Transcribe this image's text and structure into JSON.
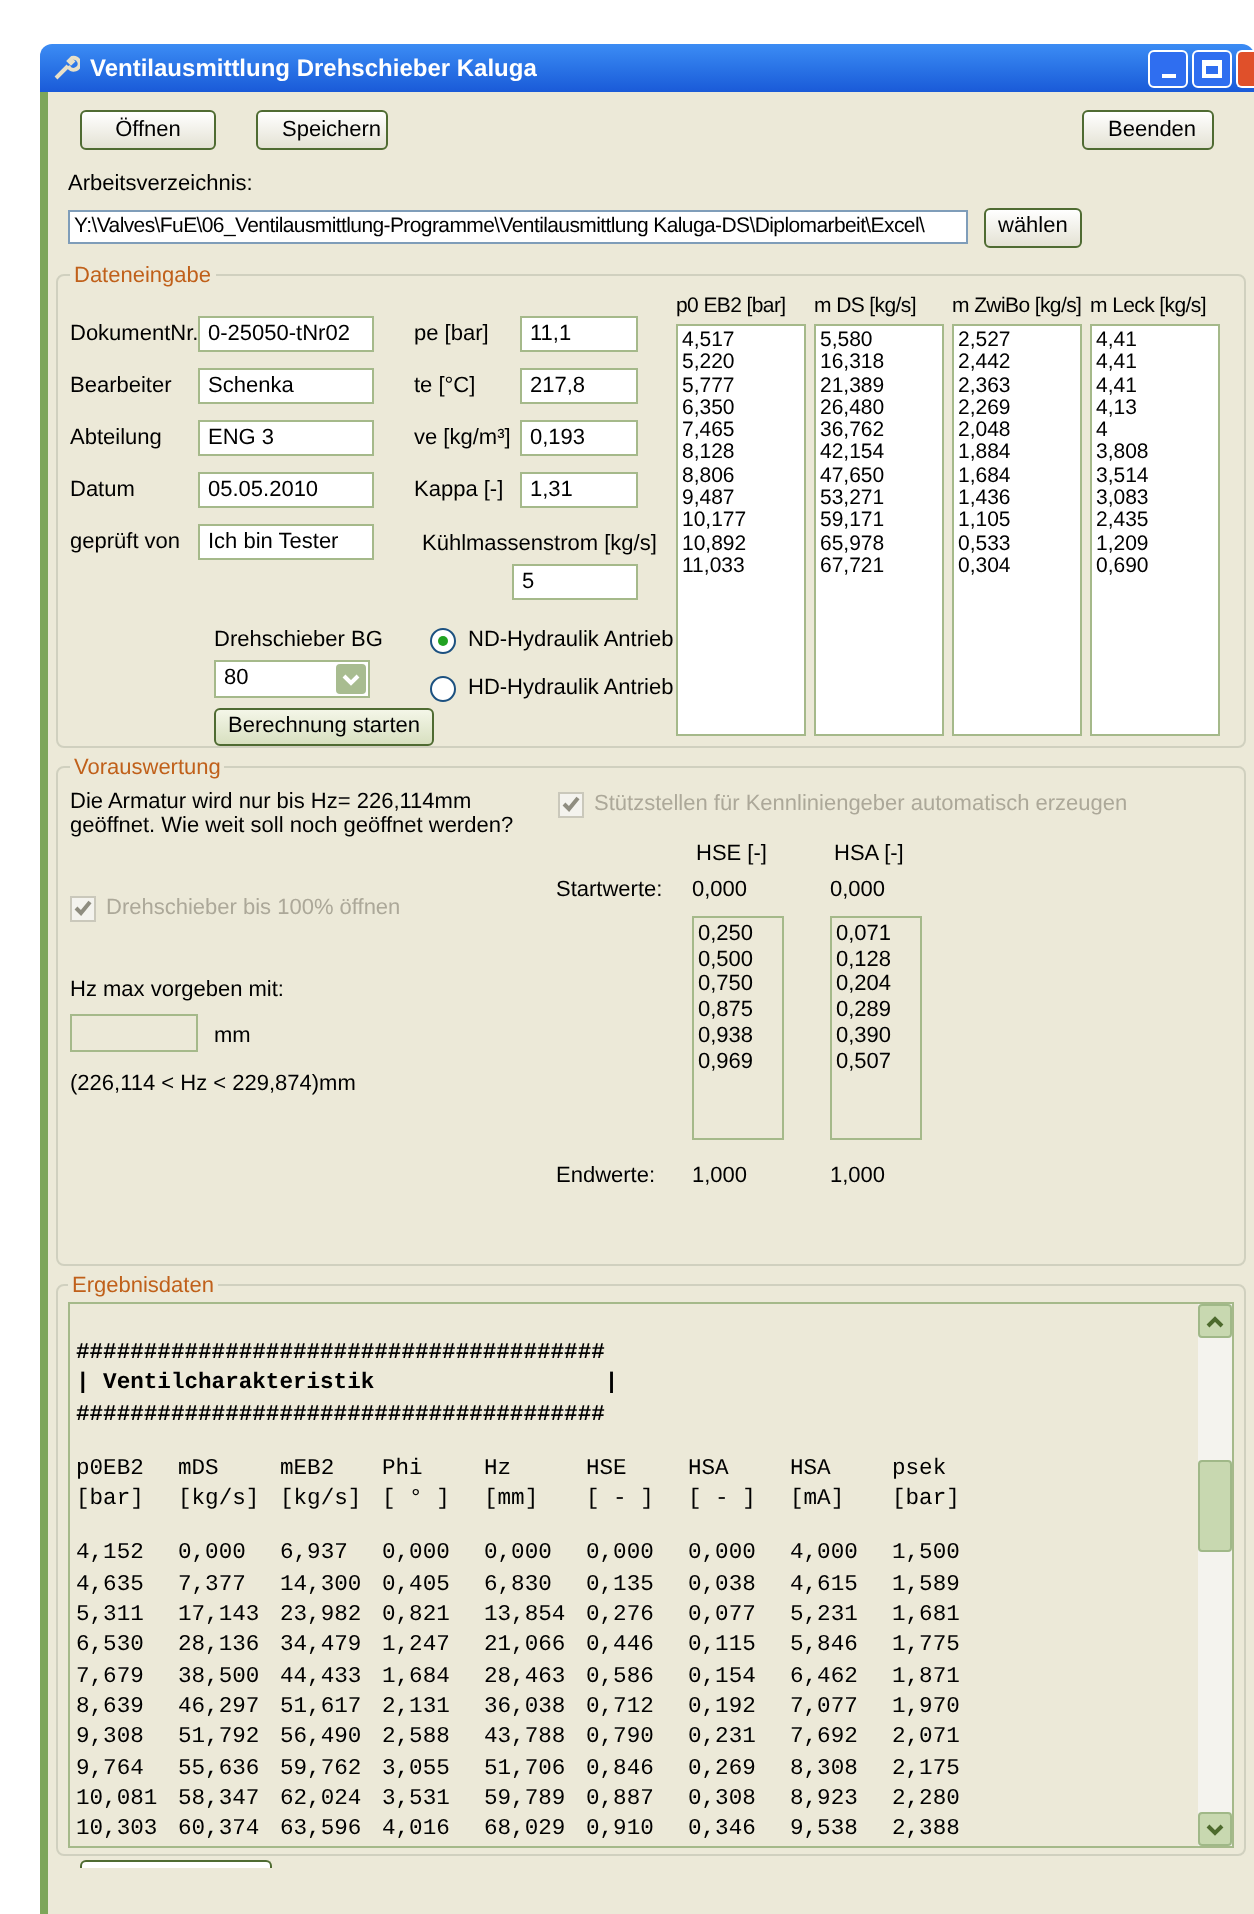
{
  "window": {
    "title": "Ventilausmittlung Drehschieber Kaluga"
  },
  "toolbar": {
    "left_buttons": [
      "Öffnen",
      "Speichern"
    ],
    "right_button": "Beenden"
  },
  "workdir": {
    "label": "Arbeitsverzeichnis:",
    "value": "Y:\\Valves\\FuE\\06_Ventilausmittlung-Programme\\Ventilausmittlung Kaluga-DS\\Diplomarbeit\\Excel\\",
    "button": "wählen"
  },
  "data_input": {
    "title": "Dateneingabe",
    "fields_left": [
      {
        "label": "DokumentNr.",
        "value": "0-25050-tNr02"
      },
      {
        "label": "Bearbeiter",
        "value": "Schenka"
      },
      {
        "label": "Abteilung",
        "value": "ENG 3"
      },
      {
        "label": "Datum",
        "value": "05.05.2010"
      },
      {
        "label": "geprüft von",
        "value": "Ich bin Tester"
      }
    ],
    "fields_right": [
      {
        "label": "pe [bar]",
        "value": "11,1"
      },
      {
        "label": "te [°C]",
        "value": "217,8"
      },
      {
        "label": "ve [kg/m³]",
        "value": "0,193"
      },
      {
        "label": "Kappa [-]",
        "value": "1,31"
      }
    ],
    "coolant": {
      "label": "Kühlmassenstrom [kg/s]",
      "value": "5"
    },
    "size": {
      "label": "Drehschieber BG",
      "value": "80"
    },
    "start_button": "Berechnung starten",
    "drive": [
      {
        "label": "ND-Hydraulik Antrieb",
        "selected": true
      },
      {
        "label": "HD-Hydraulik Antrieb",
        "selected": false
      }
    ],
    "lists": [
      {
        "header": "p0 EB2 [bar]",
        "values": [
          "4,517",
          "5,220",
          "5,777",
          "6,350",
          "7,465",
          "8,128",
          "8,806",
          "9,487",
          "10,177",
          "10,892",
          "11,033"
        ]
      },
      {
        "header": "m DS [kg/s]",
        "values": [
          "5,580",
          "16,318",
          "21,389",
          "26,480",
          "36,762",
          "42,154",
          "47,650",
          "53,271",
          "59,171",
          "65,978",
          "67,721"
        ]
      },
      {
        "header": "m ZwiBo [kg/s]",
        "values": [
          "2,527",
          "2,442",
          "2,363",
          "2,269",
          "2,048",
          "1,884",
          "1,684",
          "1,436",
          "1,105",
          "0,533",
          "0,304"
        ]
      },
      {
        "header": "m Leck [kg/s]",
        "values": [
          "4,41",
          "4,41",
          "4,41",
          "4,13",
          "4",
          "3,808",
          "3,514",
          "3,083",
          "2,435",
          "1,209",
          "0,690"
        ]
      }
    ]
  },
  "pre_evaluation": {
    "title": "Vorauswertung",
    "message": "Die Armatur wird nur bis Hz= 226,114mm geöffnet. Wie weit soll noch geöffnet werden?",
    "open_full": {
      "label": "Drehschieber bis 100% öffnen",
      "checked": true,
      "disabled": true
    },
    "hz_label": "Hz max vorgeben mit:",
    "hz_unit": "mm",
    "hz_range": "(226,114 < Hz < 229,874)mm",
    "auto_points": {
      "label": "Stützstellen für Kennliniengeber automatisch erzeugen",
      "checked": true,
      "disabled": true
    },
    "start_label": "Startwerte:",
    "end_label": "Endwerte:",
    "columns": [
      {
        "header": "HSE [-]",
        "start": "0,000",
        "values": [
          "0,250",
          "0,500",
          "0,750",
          "0,875",
          "0,938",
          "0,969"
        ],
        "end": "1,000"
      },
      {
        "header": "HSA [-]",
        "start": "0,000",
        "values": [
          "0,071",
          "0,128",
          "0,204",
          "0,289",
          "0,390",
          "0,507"
        ],
        "end": "1,000"
      }
    ]
  },
  "results": {
    "title": "Ergebnisdaten",
    "banner": [
      "#######################################",
      "| Ventilcharakteristik                 |",
      "#######################################"
    ],
    "columns": [
      {
        "name": "p0EB2",
        "unit": "[bar]"
      },
      {
        "name": "mDS",
        "unit": "[kg/s]"
      },
      {
        "name": "mEB2",
        "unit": "[kg/s]"
      },
      {
        "name": "Phi",
        "unit": "[ ° ]"
      },
      {
        "name": "Hz",
        "unit": "[mm]"
      },
      {
        "name": "HSE",
        "unit": "[ - ]"
      },
      {
        "name": "HSA",
        "unit": "[ - ]"
      },
      {
        "name": "HSA",
        "unit": "[mA]"
      },
      {
        "name": "psek",
        "unit": "[bar]"
      }
    ],
    "rows": [
      [
        "4,152",
        "0,000",
        "6,937",
        "0,000",
        "0,000",
        "0,000",
        "0,000",
        "4,000",
        "1,500"
      ],
      [
        "4,635",
        "7,377",
        "14,300",
        "0,405",
        "6,830",
        "0,135",
        "0,038",
        "4,615",
        "1,589"
      ],
      [
        "5,311",
        "17,143",
        "23,982",
        "0,821",
        "13,854",
        "0,276",
        "0,077",
        "5,231",
        "1,681"
      ],
      [
        "6,530",
        "28,136",
        "34,479",
        "1,247",
        "21,066",
        "0,446",
        "0,115",
        "5,846",
        "1,775"
      ],
      [
        "7,679",
        "38,500",
        "44,433",
        "1,684",
        "28,463",
        "0,586",
        "0,154",
        "6,462",
        "1,871"
      ],
      [
        "8,639",
        "46,297",
        "51,617",
        "2,131",
        "36,038",
        "0,712",
        "0,192",
        "7,077",
        "1,970"
      ],
      [
        "9,308",
        "51,792",
        "56,490",
        "2,588",
        "43,788",
        "0,790",
        "0,231",
        "7,692",
        "2,071"
      ],
      [
        "9,764",
        "55,636",
        "59,762",
        "3,055",
        "51,706",
        "0,846",
        "0,269",
        "8,308",
        "2,175"
      ],
      [
        "10,081",
        "58,347",
        "62,024",
        "3,531",
        "59,789",
        "0,887",
        "0,308",
        "8,923",
        "2,280"
      ],
      [
        "10,303",
        "60,374",
        "63,596",
        "4,016",
        "68,029",
        "0,910",
        "0,346",
        "9,538",
        "2,388"
      ]
    ]
  }
}
